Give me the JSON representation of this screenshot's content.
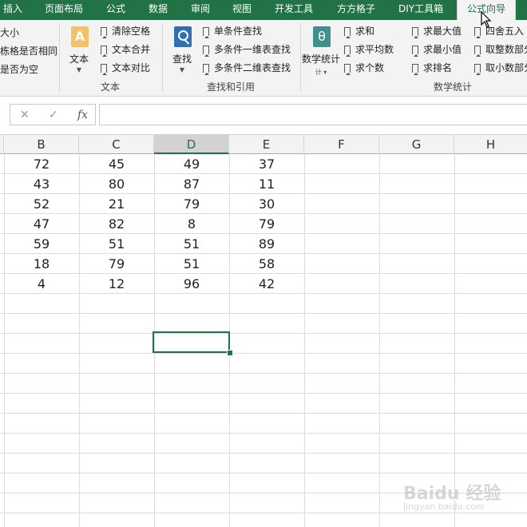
{
  "tabs": [
    "插入",
    "页面布局",
    "公式",
    "数据",
    "审阅",
    "视图",
    "开发工具",
    "方方格子",
    "DIY工具箱",
    "公式向导"
  ],
  "ribbon": {
    "cut_items": [
      "大小",
      "栋格是否相同",
      "是否为空"
    ],
    "text_group": {
      "big_label": "文本",
      "items": [
        "清除空格",
        "文本合并",
        "文本对比"
      ],
      "group_label": "文本"
    },
    "lookup_group": {
      "big_label": "查找",
      "items": [
        "单条件查找",
        "多条件一维表查找",
        "多条件二维表查找"
      ],
      "group_label": "查找和引用"
    },
    "stats_group": {
      "big_label": "数学统计",
      "big_icon_glyph": "θ",
      "col1": [
        "求和",
        "求平均数",
        "求个数"
      ],
      "col2": [
        "求最大值",
        "求最小值",
        "求排名"
      ],
      "col3": [
        "四舍五入",
        "取整数部分",
        "取小数部分"
      ],
      "group_label": "数学统计"
    }
  },
  "formula_bar": {
    "cancel_glyph": "✕",
    "enter_glyph": "✓",
    "fx_label": "fx"
  },
  "columns": [
    "B",
    "C",
    "D",
    "E",
    "F",
    "G",
    "H"
  ],
  "rows": [
    [
      "72",
      "45",
      "49",
      "37"
    ],
    [
      "43",
      "80",
      "87",
      "11"
    ],
    [
      "52",
      "21",
      "79",
      "30"
    ],
    [
      "47",
      "82",
      "8",
      "79"
    ],
    [
      "59",
      "51",
      "51",
      "89"
    ],
    [
      "18",
      "79",
      "51",
      "58"
    ],
    [
      "4",
      "12",
      "96",
      "42"
    ]
  ],
  "watermark": {
    "text": "Baidu 经验",
    "sub": "jingyan.baidu.com"
  },
  "colors": {
    "accent": "#217346",
    "ribbon_bg": "#f3f3f3",
    "gridline": "#dcdcdc"
  }
}
